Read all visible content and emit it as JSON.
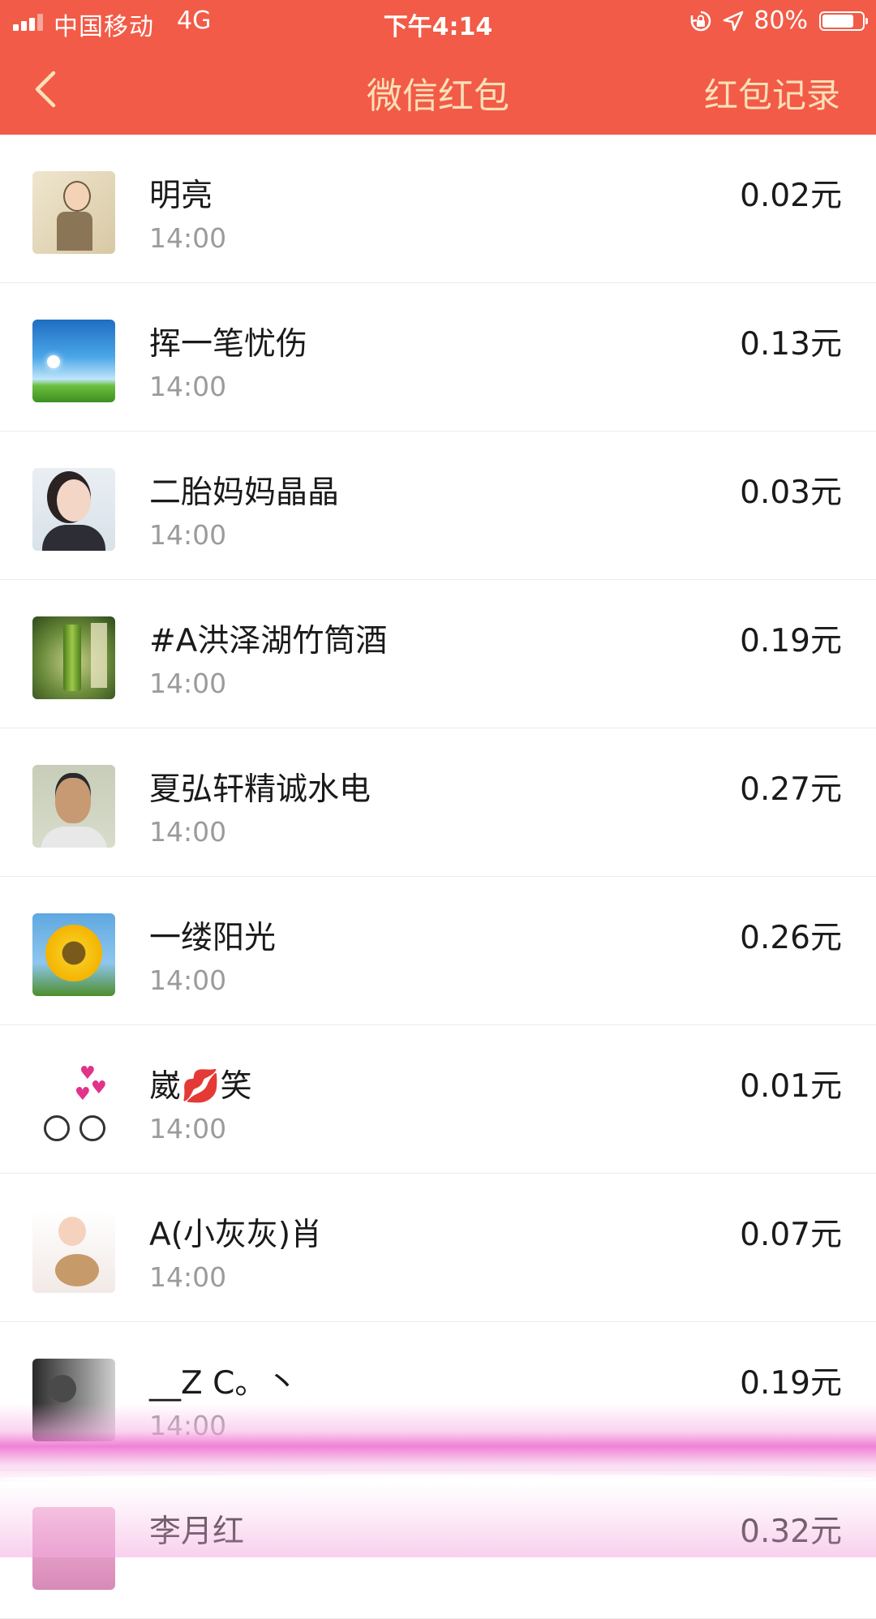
{
  "status_bar": {
    "carrier": "中国移动",
    "network": "4G",
    "time": "下午4:14",
    "battery": "80%",
    "battery_level": 0.8,
    "icons": [
      "signal-icon",
      "lock-rotation-icon",
      "location-arrow-icon",
      "battery-icon"
    ]
  },
  "nav": {
    "back_icon": "chevron-left-icon",
    "title": "微信红包",
    "record_label": "红包记录"
  },
  "colors": {
    "header_bg": "#f25b47",
    "header_text": "#fbe0b8",
    "name_text": "#1a1a1a",
    "time_text": "#9b9b9b",
    "divider": "#ececec",
    "highlight_pink": "#ec6cce"
  },
  "list": [
    {
      "name": "明亮",
      "time": "14:00",
      "amount": "0.02元"
    },
    {
      "name": "挥一笔忧伤",
      "time": "14:00",
      "amount": "0.13元"
    },
    {
      "name": "二胎妈妈晶晶",
      "time": "14:00",
      "amount": "0.03元"
    },
    {
      "name": "#A洪泽湖竹筒酒",
      "time": "14:00",
      "amount": "0.19元"
    },
    {
      "name": "夏弘轩精诚水电",
      "time": "14:00",
      "amount": "0.27元"
    },
    {
      "name": "一缕阳光",
      "time": "14:00",
      "amount": "0.26元"
    },
    {
      "name": "崴💋笑",
      "time": "14:00",
      "amount": "0.01元"
    },
    {
      "name": "A(小灰灰)肖",
      "time": "14:00",
      "amount": "0.07元"
    },
    {
      "name": "__Z C。丶",
      "time": "14:00",
      "amount": "0.19元"
    },
    {
      "name": "李月红",
      "time": "",
      "amount": "0.32元"
    }
  ]
}
